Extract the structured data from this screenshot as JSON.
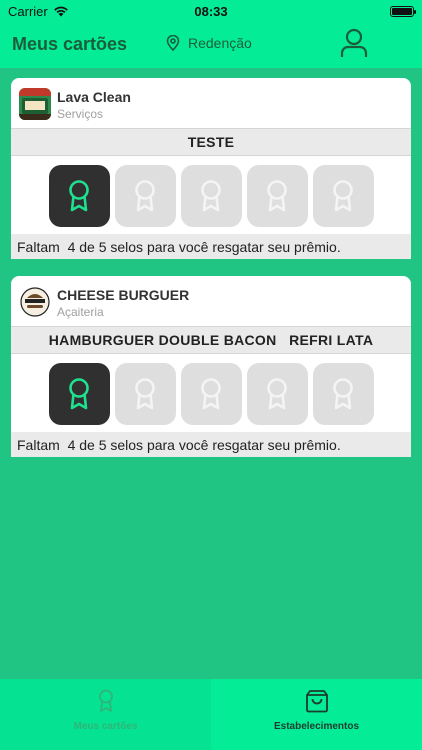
{
  "status_bar": {
    "carrier": "Carrier",
    "time": "08:33"
  },
  "nav": {
    "title": "Meus cartões",
    "location": "Redenção",
    "icons": [
      "location-pin-icon",
      "profile-icon"
    ]
  },
  "cards": [
    {
      "name": "Lava Clean",
      "category": "Serviços",
      "reward": "TESTE",
      "stamps_total": 5,
      "stamps_collected": 1,
      "footer": "Faltam  4 de 5 selos para você resgatar seu prêmio."
    },
    {
      "name": "CHEESE BURGUER",
      "category": "Açaiteria",
      "reward": "HAMBURGUER DOUBLE BACON   REFRI LATA",
      "stamps_total": 5,
      "stamps_collected": 1,
      "footer": "Faltam  4 de 5 selos para você resgatar seu prêmio."
    }
  ],
  "tabs": [
    {
      "label": "Meus cartões",
      "icon": "award-icon",
      "selected": false
    },
    {
      "label": "Estabelecimentos",
      "icon": "shopping-bag-icon",
      "selected": true
    }
  ],
  "colors": {
    "accent": "#05ec96",
    "background": "#20c483",
    "stamp_active": "#303030",
    "stamp_empty": "#dedede",
    "stamp_icon_active": "#1fe08e"
  }
}
